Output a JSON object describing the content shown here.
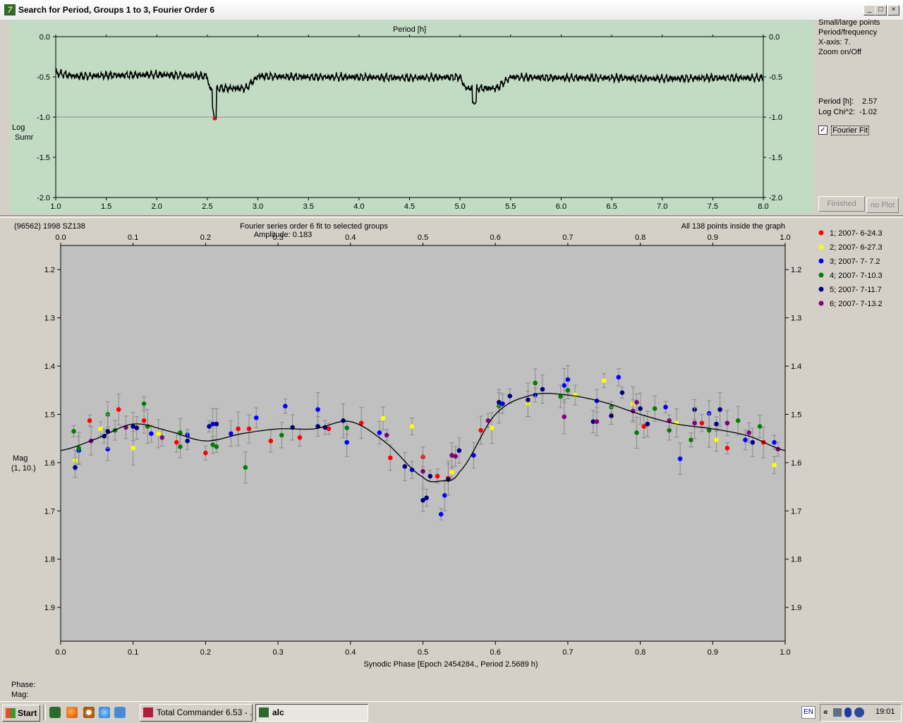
{
  "window": {
    "title": "Search for Period, Groups 1 to 3, Fourier Order 6",
    "min": "_",
    "max": "□",
    "close": "×",
    "icon": "7"
  },
  "period_plot": {
    "x_title": "Period [h]",
    "y_label_1": "Log",
    "y_label_2": "Sumr",
    "x_ticks": [
      "1.0",
      "1.5",
      "2.0",
      "2.5",
      "3.0",
      "3.5",
      "4.0",
      "4.5",
      "5.0",
      "5.5",
      "6.0",
      "6.5",
      "7.0",
      "7.5",
      "8.0"
    ],
    "y_ticks": [
      "0.0",
      "-0.5",
      "-1.0",
      "-1.5",
      "-2.0"
    ],
    "background": "#c1dcc3"
  },
  "side": {
    "small_large": "Small/large points",
    "period_freq": "Period/frequency",
    "xaxis": "X-axis: 7.",
    "zoom": "Zoom on/Off",
    "period_label": "Period [h]:",
    "period_value": "2.57",
    "chi_label": "Log Chi^2:",
    "chi_value": "-1.02",
    "fourier_fit": "Fourier Fit",
    "fourier_checked": "✓",
    "finished": "Finished",
    "no_plot": "no Plot"
  },
  "lc": {
    "object": "(96562) 1998 SZ138",
    "fit_title": "Fourier series order 6 fit to selected groups",
    "amplitude": "Amplitude: 0.183",
    "inside": "All 138 points inside the graph",
    "ylabel": "Mag",
    "ylabel2": "(1, 10.)",
    "xlabel": "Synodic Phase [Epoch 2454284., Period 2.5689 h)",
    "x_ticks": [
      "0.0",
      "0.1",
      "0.2",
      "0.3",
      "0.4",
      "0.5",
      "0.6",
      "0.7",
      "0.8",
      "0.9",
      "1.0"
    ],
    "y_ticks": [
      "1.2",
      "1.3",
      "1.4",
      "1.5",
      "1.6",
      "1.7",
      "1.8",
      "1.9"
    ],
    "background": "#c0c0c0",
    "legend": [
      {
        "label": "1; 2007- 6-24.3",
        "color": "#ff0000"
      },
      {
        "label": "2; 2007- 6-27.3",
        "color": "#ffff00"
      },
      {
        "label": "3; 2007- 7- 7.2",
        "color": "#0000ff"
      },
      {
        "label": "4; 2007- 7-10.3",
        "color": "#008000"
      },
      {
        "label": "5; 2007- 7-11.7",
        "color": "#000080"
      },
      {
        "label": "6; 2007- 7-13.2",
        "color": "#800080"
      }
    ]
  },
  "status": {
    "phase": "Phase:",
    "mag": "Mag:"
  },
  "taskbar": {
    "start": "Start",
    "task1": "Total Commander 6.53 - ...",
    "task2": "alc",
    "lang": "EN",
    "chevron": "«",
    "clock": "19:01"
  },
  "chart_data": [
    {
      "type": "line",
      "x": [
        1.0,
        1.2,
        1.5,
        2.0,
        2.5,
        2.57,
        3.0,
        3.5,
        4.0,
        4.5,
        5.0,
        5.14,
        5.5,
        6.0,
        6.5,
        7.0,
        7.5,
        8.0
      ],
      "series": [
        {
          "values": [
            -0.43,
            -0.47,
            -0.46,
            -0.45,
            -0.47,
            -1.02,
            -0.47,
            -0.48,
            -0.48,
            -0.49,
            -0.48,
            -0.84,
            -0.48,
            -0.49,
            -0.49,
            -0.5,
            -0.49,
            -0.49
          ]
        }
      ],
      "xlabel": "Period [h]",
      "ylabel": "Log Sumr",
      "xlim": [
        1.0,
        8.0
      ],
      "ylim": [
        -2.0,
        0.0
      ],
      "grid": true
    },
    {
      "type": "scatter",
      "xlabel": "Synodic Phase [Epoch 2454284., Period 2.5689 h)",
      "ylabel": "Mag",
      "xlim": [
        0.0,
        1.0
      ],
      "ylim": [
        1.2,
        1.97
      ],
      "y_inverted": true,
      "fit_curve": {
        "x": [
          0.0,
          0.05,
          0.1,
          0.15,
          0.2,
          0.25,
          0.3,
          0.35,
          0.4,
          0.45,
          0.5,
          0.525,
          0.55,
          0.6,
          0.65,
          0.7,
          0.75,
          0.8,
          0.85,
          0.9,
          0.95,
          1.0
        ],
        "y": [
          1.575,
          1.55,
          1.52,
          1.535,
          1.555,
          1.54,
          1.53,
          1.53,
          1.515,
          1.56,
          1.63,
          1.638,
          1.62,
          1.5,
          1.46,
          1.46,
          1.475,
          1.5,
          1.52,
          1.53,
          1.545,
          1.575
        ]
      },
      "series": [
        {
          "name": "1; 2007- 6-24.3",
          "points": [
            [
              0.04,
              1.513
            ],
            [
              0.08,
              1.49
            ],
            [
              0.115,
              1.513
            ],
            [
              0.16,
              1.558
            ],
            [
              0.2,
              1.58
            ],
            [
              0.245,
              1.53
            ],
            [
              0.26,
              1.53
            ],
            [
              0.29,
              1.555
            ],
            [
              0.33,
              1.548
            ],
            [
              0.37,
              1.53
            ],
            [
              0.415,
              1.518
            ],
            [
              0.455,
              1.59
            ],
            [
              0.5,
              1.588
            ],
            [
              0.52,
              1.628
            ],
            [
              0.535,
              1.632
            ],
            [
              0.58,
              1.533
            ],
            [
              0.805,
              1.525
            ],
            [
              0.885,
              1.518
            ],
            [
              0.92,
              1.57
            ],
            [
              0.97,
              1.558
            ]
          ]
        },
        {
          "name": "2; 2007- 6-27.3",
          "points": [
            [
              0.02,
              1.595
            ],
            [
              0.055,
              1.53
            ],
            [
              0.1,
              1.57
            ],
            [
              0.135,
              1.54
            ],
            [
              0.445,
              1.508
            ],
            [
              0.485,
              1.525
            ],
            [
              0.54,
              1.62
            ],
            [
              0.595,
              1.528
            ],
            [
              0.645,
              1.478
            ],
            [
              0.71,
              1.46
            ],
            [
              0.75,
              1.43
            ],
            [
              0.79,
              1.478
            ],
            [
              0.85,
              1.518
            ],
            [
              0.905,
              1.553
            ],
            [
              0.985,
              1.605
            ]
          ]
        },
        {
          "name": "3; 2007- 7- 7.2",
          "points": [
            [
              0.025,
              1.575
            ],
            [
              0.065,
              1.572
            ],
            [
              0.125,
              1.54
            ],
            [
              0.175,
              1.543
            ],
            [
              0.21,
              1.52
            ],
            [
              0.235,
              1.54
            ],
            [
              0.27,
              1.507
            ],
            [
              0.31,
              1.483
            ],
            [
              0.355,
              1.49
            ],
            [
              0.395,
              1.558
            ],
            [
              0.44,
              1.538
            ],
            [
              0.485,
              1.615
            ],
            [
              0.525,
              1.707
            ],
            [
              0.53,
              1.668
            ],
            [
              0.57,
              1.585
            ],
            [
              0.61,
              1.478
            ],
            [
              0.655,
              1.46
            ],
            [
              0.695,
              1.44
            ],
            [
              0.7,
              1.428
            ],
            [
              0.74,
              1.472
            ],
            [
              0.77,
              1.423
            ],
            [
              0.835,
              1.485
            ],
            [
              0.855,
              1.592
            ],
            [
              0.895,
              1.498
            ],
            [
              0.945,
              1.553
            ],
            [
              0.985,
              1.558
            ]
          ]
        },
        {
          "name": "4; 2007- 7-10.3",
          "points": [
            [
              0.018,
              1.535
            ],
            [
              0.025,
              1.57
            ],
            [
              0.065,
              1.5
            ],
            [
              0.075,
              1.533
            ],
            [
              0.115,
              1.478
            ],
            [
              0.12,
              1.525
            ],
            [
              0.165,
              1.538
            ],
            [
              0.165,
              1.567
            ],
            [
              0.21,
              1.563
            ],
            [
              0.215,
              1.567
            ],
            [
              0.255,
              1.61
            ],
            [
              0.305,
              1.543
            ],
            [
              0.355,
              1.525
            ],
            [
              0.395,
              1.528
            ],
            [
              0.605,
              1.483
            ],
            [
              0.655,
              1.435
            ],
            [
              0.69,
              1.463
            ],
            [
              0.7,
              1.45
            ],
            [
              0.76,
              1.485
            ],
            [
              0.795,
              1.538
            ],
            [
              0.82,
              1.488
            ],
            [
              0.84,
              1.533
            ],
            [
              0.87,
              1.553
            ],
            [
              0.895,
              1.533
            ],
            [
              0.935,
              1.513
            ],
            [
              0.965,
              1.525
            ]
          ]
        },
        {
          "name": "5; 2007- 7-11.7",
          "points": [
            [
              0.02,
              1.61
            ],
            [
              0.06,
              1.545
            ],
            [
              0.065,
              1.535
            ],
            [
              0.1,
              1.525
            ],
            [
              0.105,
              1.528
            ],
            [
              0.175,
              1.555
            ],
            [
              0.205,
              1.525
            ],
            [
              0.215,
              1.52
            ],
            [
              0.32,
              1.527
            ],
            [
              0.355,
              1.525
            ],
            [
              0.365,
              1.527
            ],
            [
              0.39,
              1.513
            ],
            [
              0.475,
              1.608
            ],
            [
              0.5,
              1.678
            ],
            [
              0.505,
              1.673
            ],
            [
              0.51,
              1.628
            ],
            [
              0.535,
              1.635
            ],
            [
              0.55,
              1.575
            ],
            [
              0.605,
              1.475
            ],
            [
              0.62,
              1.462
            ],
            [
              0.645,
              1.47
            ],
            [
              0.665,
              1.448
            ],
            [
              0.735,
              1.515
            ],
            [
              0.76,
              1.503
            ],
            [
              0.775,
              1.455
            ],
            [
              0.8,
              1.488
            ],
            [
              0.81,
              1.52
            ],
            [
              0.875,
              1.49
            ],
            [
              0.905,
              1.52
            ],
            [
              0.91,
              1.49
            ],
            [
              0.955,
              1.558
            ]
          ]
        },
        {
          "name": "6; 2007- 7-13.2",
          "points": [
            [
              0.042,
              1.555
            ],
            [
              0.09,
              1.527
            ],
            [
              0.14,
              1.548
            ],
            [
              0.45,
              1.543
            ],
            [
              0.5,
              1.618
            ],
            [
              0.54,
              1.585
            ],
            [
              0.545,
              1.587
            ],
            [
              0.59,
              1.513
            ],
            [
              0.695,
              1.505
            ],
            [
              0.74,
              1.515
            ],
            [
              0.79,
              1.493
            ],
            [
              0.795,
              1.475
            ],
            [
              0.84,
              1.513
            ],
            [
              0.875,
              1.518
            ],
            [
              0.92,
              1.518
            ],
            [
              0.95,
              1.538
            ],
            [
              0.99,
              1.572
            ]
          ]
        }
      ]
    }
  ]
}
